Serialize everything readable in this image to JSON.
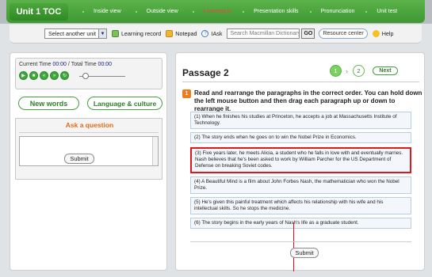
{
  "nav": {
    "unit_title": "Unit 1 TOC",
    "tabs": [
      "Inside view",
      "Outside view",
      "Listening in",
      "Presentation skills",
      "Pronunciation",
      "Unit test"
    ],
    "active_tab": "Listening in"
  },
  "toolbar": {
    "select_unit": "Select another unit",
    "learning_record": "Learning record",
    "notepad": "Notepad",
    "iask": "IAsk",
    "search_placeholder": "Search Macmillan Dictionary",
    "go": "GO",
    "resource_center": "Resource center",
    "help": "Help"
  },
  "player": {
    "current_label": "Current Time",
    "current_value": "00:00",
    "separator": "/",
    "total_label": "Total Time",
    "total_value": "00:00"
  },
  "left": {
    "new_words": "New words",
    "language_culture": "Language & culture",
    "ask_title": "Ask a question",
    "submit": "Submit"
  },
  "main": {
    "passage_title": "Passage 2",
    "page_current": "1",
    "page_next": "2",
    "next_label": "Next",
    "instruction_number": "1",
    "instruction": "Read and rearrange the paragraphs in the correct order. You can hold down the left mouse button and then drag each paragraph up or down to rearrange it.",
    "paragraphs": [
      "(1) When he finishes his studies at Princeton, he accepts a job at Massachusetts Institute of Technology.",
      "(2) The story ends when he goes on to win the Nobel Prize in Economics.",
      "(3) Five years later, he meets Alicia, a student who he falls in love with and eventually marries. Nash believes that he's been asked to work by William Parcher for the US Department of Defense on breaking Soviet codes.",
      "(4) A Beautiful Mind is a film about John Forbes Nash, the mathematician who won the Nobel Prize.",
      "(5) He's given this painful treatment which affects his relationship with his wife and his intellectual skills. So he stops the medicine.",
      "(6) The story begins in the early years of Nash's life as a graduate student."
    ],
    "submit": "Submit"
  },
  "colors": {
    "nav_green": "#3f9832",
    "active_tab": "#e14848",
    "highlight_border": "#e0171f",
    "instruction_badge": "#ee7b1c"
  }
}
